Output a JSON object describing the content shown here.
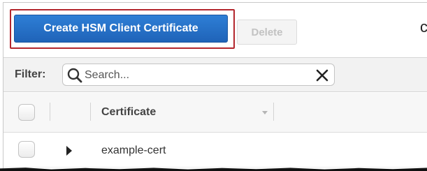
{
  "toolbar": {
    "create_label": "Create HSM Client Certificate",
    "delete_label": "Delete",
    "edge_text": "c"
  },
  "filter": {
    "label": "Filter:",
    "placeholder": "Search...",
    "value": ""
  },
  "table": {
    "columns": [
      "Certificate"
    ],
    "rows": [
      {
        "name": "example-cert"
      }
    ]
  },
  "colors": {
    "primary_button": "#1f63b8",
    "highlight": "#b3262d",
    "filter_bg": "#f2f2f2"
  }
}
